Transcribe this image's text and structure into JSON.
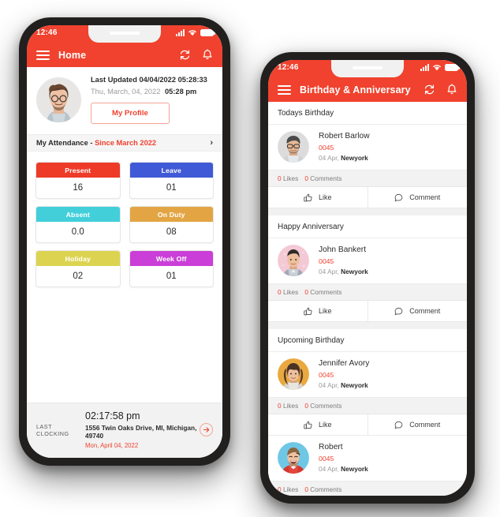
{
  "phone1": {
    "status_bar": {
      "time": "12:46",
      "signal_icon": "cellular-bars-icon",
      "wifi_icon": "wifi-icon",
      "battery_icon": "battery-icon"
    },
    "appbar": {
      "menu_icon": "hamburger-menu-icon",
      "title": "Home",
      "refresh_icon": "refresh-icon",
      "notification_icon": "bell-icon"
    },
    "profile": {
      "avatar": "user-avatar-photo",
      "last_updated": "Last Updated 04/04/2022 05:28:33",
      "date_text": "Thu, March, 04, 2022",
      "time_text": "05:28 pm",
      "profile_button": "My Profile"
    },
    "attendance_bar": {
      "label": "My Attendance -",
      "period": "Since March 2022",
      "chevron_icon": "chevron-right-icon"
    },
    "stats": [
      {
        "label": "Present",
        "value": "16",
        "color": "#ee3b28"
      },
      {
        "label": "Leave",
        "value": "01",
        "color": "#4059d6"
      },
      {
        "label": "Absent",
        "value": "0.0",
        "color": "#42cfda"
      },
      {
        "label": "On Duty",
        "value": "08",
        "color": "#e3a544"
      },
      {
        "label": "Holiday",
        "value": "02",
        "color": "#dcd450"
      },
      {
        "label": "Week Off",
        "value": "01",
        "color": "#ca3fd7"
      }
    ],
    "clocking": {
      "label": "LAST CLOCKING",
      "time": "02:17:58 pm",
      "address": "1556 Twin Oaks Drive, MI, Michigan, 49740",
      "date": "Mon, April 04, 2022",
      "arrow_icon": "arrow-right-circle-icon"
    }
  },
  "phone2": {
    "status_bar": {
      "time": "12:46",
      "signal_icon": "cellular-bars-icon",
      "wifi_icon": "wifi-icon",
      "battery_icon": "battery-icon"
    },
    "appbar": {
      "menu_icon": "hamburger-menu-icon",
      "title": "Birthday & Anniversary",
      "refresh_icon": "refresh-icon",
      "notification_icon": "bell-icon"
    },
    "action_labels": {
      "like": "Like",
      "comment": "Comment",
      "like_icon": "thumbs-up-icon",
      "comment_icon": "comment-bubble-icon"
    },
    "sections": [
      {
        "title": "Todays Birthday",
        "entries": [
          {
            "name": "Robert Barlow",
            "code": "0045",
            "date": "04 Apr,",
            "location": "Newyork",
            "likes": "0",
            "likes_label": "Likes",
            "comments": "0",
            "comments_label": "Comments",
            "avatar_bg": "#dcdcdc"
          }
        ]
      },
      {
        "title": "Happy Anniversary",
        "entries": [
          {
            "name": "John  Bankert",
            "code": "0045",
            "date": "04 Apr,",
            "location": "Newyork",
            "likes": "0",
            "likes_label": "Likes",
            "comments": "0",
            "comments_label": "Comments",
            "avatar_bg": "#f3c9d5"
          }
        ]
      },
      {
        "title": "Upcoming Birthday",
        "entries": [
          {
            "name": "Jennifer Avory",
            "code": "0045",
            "date": "04 Apr,",
            "location": "Newyork",
            "likes": "0",
            "likes_label": "Likes",
            "comments": "0",
            "comments_label": "Comments",
            "avatar_bg": "#e9a93f"
          },
          {
            "name": "Robert",
            "code": "0045",
            "date": "04 Apr,",
            "location": "Newyork",
            "likes": "0",
            "likes_label": "Likes",
            "comments": "0",
            "comments_label": "Comments",
            "avatar_bg": "#6fc7e6"
          }
        ]
      }
    ]
  }
}
